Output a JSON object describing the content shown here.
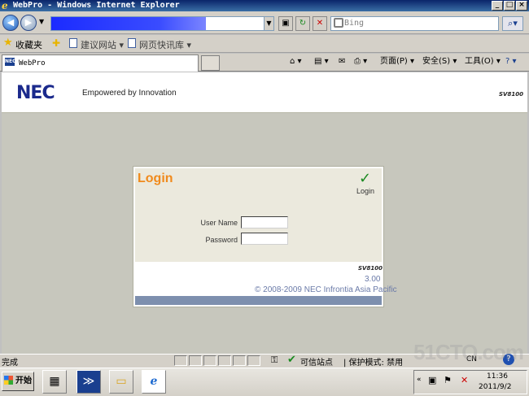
{
  "window": {
    "title": "WebPro - Windows Internet Explorer",
    "controls": [
      "_",
      "□",
      "×"
    ]
  },
  "navigation": {
    "back_icon": "back-arrow-icon",
    "forward_icon": "forward-arrow-icon",
    "address_value": "",
    "search_placeholder": "Bing",
    "search_go": "⌕▾"
  },
  "favorites": {
    "label": "收藏夹",
    "links": [
      {
        "label": "建议网站 ▾"
      },
      {
        "label": "网页快讯库 ▾"
      }
    ]
  },
  "tab": {
    "icon_text": "NEC",
    "title": "WebPro"
  },
  "commandbar": {
    "home": "⌂ ▾",
    "feeds": "▤ ▾",
    "mail": "✉",
    "print": "⎙ ▾",
    "page": "页面(P) ▾",
    "safety": "安全(S) ▾",
    "tools": "工具(O) ▾",
    "help": "? ▾"
  },
  "page_header": {
    "logo": "NEC",
    "tagline": "Empowered by Innovation",
    "model": "SV8100"
  },
  "login": {
    "title": "Login",
    "check_label": "Login",
    "username_label": "User Name",
    "username_value": "",
    "password_label": "Password",
    "password_value": "",
    "model": "SV8100",
    "version": "3.00",
    "copyright": "© 2008-2009 NEC Infrontia Asia Pacific"
  },
  "statusbar": {
    "status": "完成",
    "zone": "可信站点",
    "protected_mode": "| 保护模式: 禁用",
    "lang": "CN"
  },
  "taskbar": {
    "start": "开始",
    "time": "11:36",
    "date": "2011/9/2"
  },
  "watermark": "51CTO.com",
  "colors": {
    "nec_blue": "#1b2a8c",
    "login_orange": "#f08a1c",
    "content_bg": "#c7c7bd",
    "login_panel_bg": "#ebe9dd"
  }
}
